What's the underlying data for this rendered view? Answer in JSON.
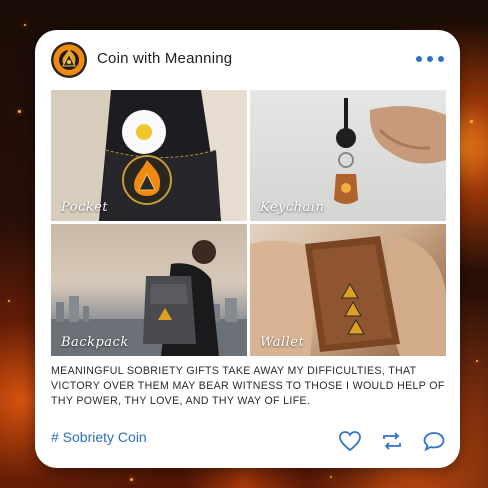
{
  "post": {
    "title": "Coin with Meanning",
    "avatar_icon": "coin-logo-icon",
    "more_icon": "more-dots-icon",
    "tiles": [
      {
        "label": "Pocket"
      },
      {
        "label": "Keychain"
      },
      {
        "label": "Backpack"
      },
      {
        "label": "Wallet"
      }
    ],
    "caption": "MEANINGFUL SOBRIETY GIFTS TAKE AWAY MY DIFFICULTIES, THAT VICTORY OVER THEM MAY BEAR WITNESS TO THOSE I WOULD HELP OF THY POWER, THY LOVE, AND THY WAY OF LIFE.",
    "hashtag": "# Sobriety Coin",
    "actions": [
      "heart-icon",
      "repost-icon",
      "comment-icon"
    ]
  },
  "colors": {
    "accent": "#2c73c9",
    "card": "#ffffff"
  }
}
